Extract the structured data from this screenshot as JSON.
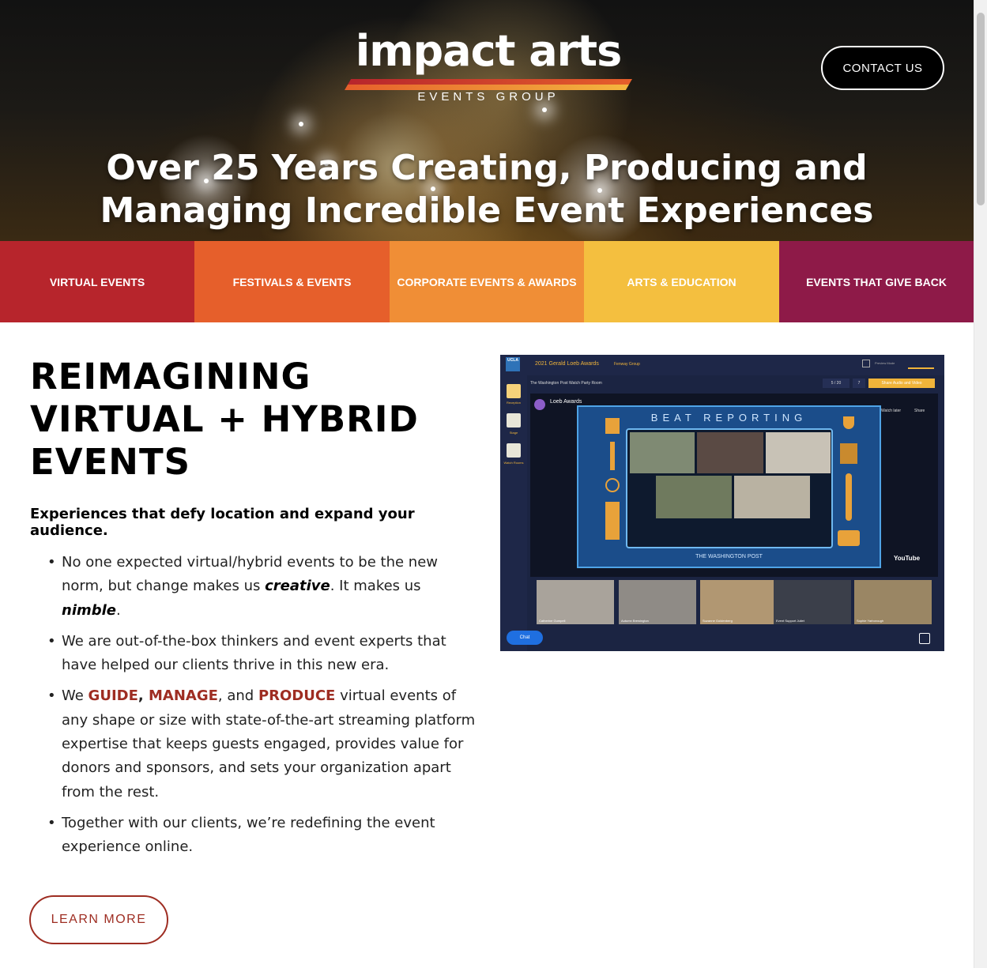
{
  "header": {
    "logo_word": "impact arts",
    "logo_sub": "EVENTS GROUP",
    "contact_label": "CONTACT US",
    "hero_line1": "Over 25 Years Creating, Producing and",
    "hero_line2": "Managing Incredible Event Experiences",
    "logo_colors": [
      "#b7252c",
      "#e65f2b",
      "#f4b63f"
    ]
  },
  "nav": {
    "items": [
      {
        "label": "VIRTUAL EVENTS",
        "color": "#b7252c"
      },
      {
        "label": "FESTIVALS & EVENTS",
        "color": "#e65f2b"
      },
      {
        "label": "CORPORATE EVENTS & AWARDS",
        "color": "#f08e36"
      },
      {
        "label": "ARTS & EDUCATION",
        "color": "#f4bf3f"
      },
      {
        "label": "EVENTS THAT GIVE BACK",
        "color": "#8e1a48"
      }
    ]
  },
  "main": {
    "heading_line1": "REIMAGINING",
    "heading_line2": "VIRTUAL + HYBRID",
    "heading_line3": "EVENTS",
    "lead": "Experiences that defy location and expand your audience.",
    "bullet1_a": "No one expected virtual/hybrid events to be the new norm, but change makes us ",
    "bullet1_b": "creative",
    "bullet1_c": ". It makes us ",
    "bullet1_d": "nimble",
    "bullet1_e": ".",
    "bullet2": "We are out-of-the-box thinkers and event experts that have helped our clients thrive in this new era.",
    "bullet3_a": "We ",
    "bullet3_guide": "GUIDE",
    "bullet3_comma": ", ",
    "bullet3_manage": "MANAGE",
    "bullet3_and": ", and ",
    "bullet3_produce": "PRODUCE",
    "bullet3_rest": " virtual events of any shape or size with state-of-the-art streaming platform expertise that keeps guests engaged, provides value for donors and sponsors, and sets your organization apart from the rest.",
    "bullet4": "Together with our clients, we’re redefining the event experience online.",
    "learn_more": "LEARN MORE",
    "accent_color": "#9e2d22"
  },
  "screenshot": {
    "badge": "UCLA",
    "event_title": "2021 Gerald Loeb Awards",
    "group": "Fenway Group",
    "preview": "Preview Mode",
    "room": "The Washington Post Watch Party Room",
    "pager": "5 / 20",
    "pager2": "7",
    "share_av": "Share Audio and Video",
    "sidebar": [
      "Reception",
      "Stage",
      "Watch Rooms"
    ],
    "stream_name": "Loeb Awards",
    "board_title": "BEAT REPORTING",
    "board_footer": "THE WASHINGTON POST",
    "watch_later": "Watch later",
    "share": "Share",
    "youtube": "YouTube",
    "attendees": [
      "Catherine Gumpell",
      "Autumn Brewington",
      "Suzanne Goldenberg",
      "Event Support Juliet",
      "Sophie Yarborough"
    ],
    "chat": "Chat"
  }
}
